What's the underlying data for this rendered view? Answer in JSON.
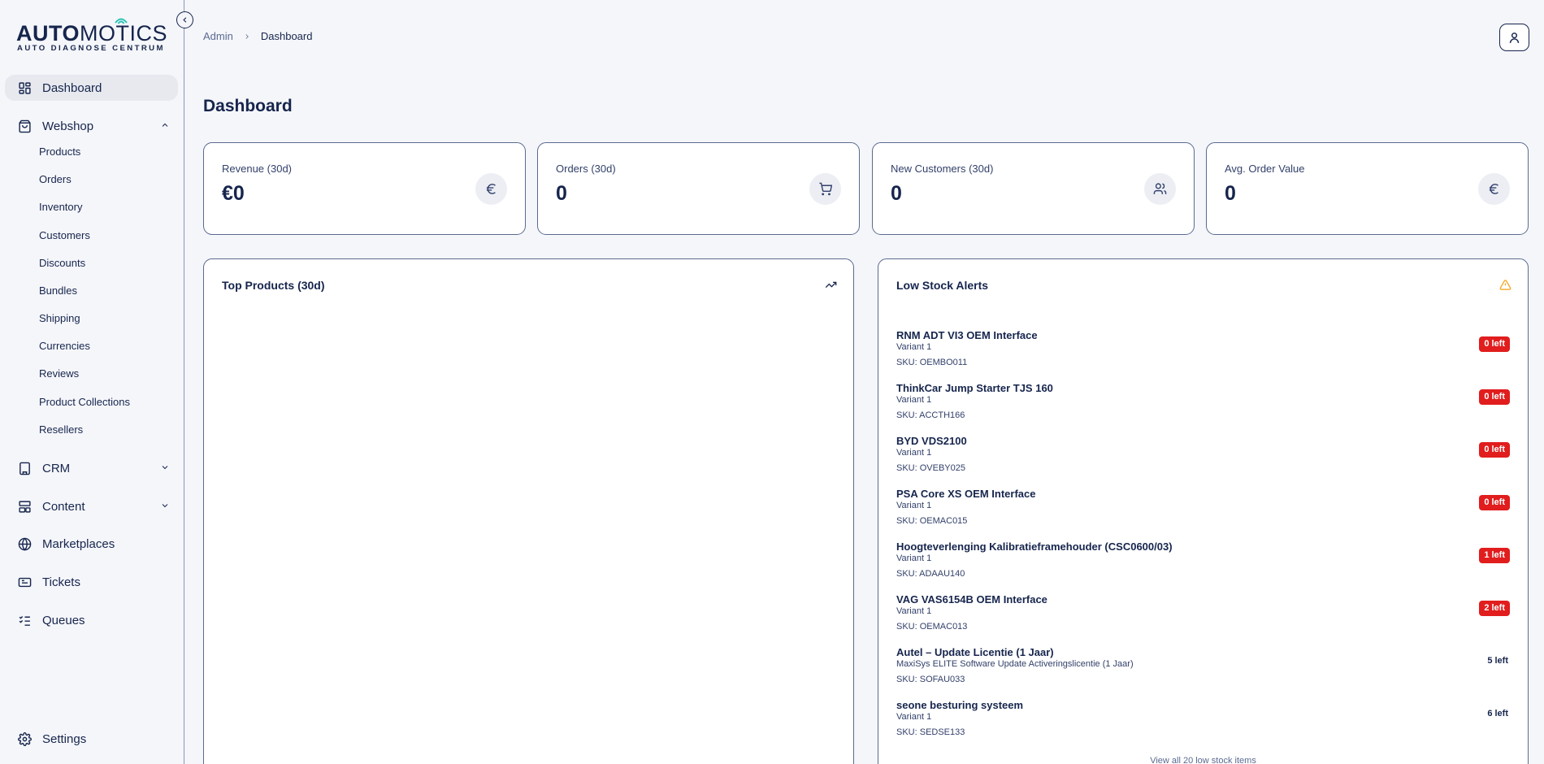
{
  "brand": {
    "name_bold": "AUTO",
    "name_light": "MOTICS",
    "tagline": "AUTO DIAGNOSE CENTRUM",
    "accent_color": "#2ec4b6"
  },
  "sidebar": {
    "items": [
      {
        "label": "Dashboard",
        "icon": "grid-icon",
        "active": true
      },
      {
        "label": "Webshop",
        "icon": "shopping-bag-icon",
        "expanded": true
      },
      {
        "label": "CRM",
        "icon": "building-icon",
        "expanded": false
      },
      {
        "label": "Content",
        "icon": "layout-icon",
        "expanded": false
      },
      {
        "label": "Marketplaces",
        "icon": "globe-icon"
      },
      {
        "label": "Tickets",
        "icon": "ticket-icon"
      },
      {
        "label": "Queues",
        "icon": "list-checks-icon"
      }
    ],
    "webshop_children": [
      "Products",
      "Orders",
      "Inventory",
      "Customers",
      "Discounts",
      "Bundles",
      "Shipping",
      "Currencies",
      "Reviews",
      "Product Collections",
      "Resellers"
    ],
    "settings_label": "Settings"
  },
  "breadcrumb": {
    "root": "Admin",
    "current": "Dashboard"
  },
  "page": {
    "title": "Dashboard"
  },
  "stats": [
    {
      "label": "Revenue (30d)",
      "value": "€0",
      "icon": "euro-icon"
    },
    {
      "label": "Orders (30d)",
      "value": "0",
      "icon": "cart-icon"
    },
    {
      "label": "New Customers (30d)",
      "value": "0",
      "icon": "users-icon"
    },
    {
      "label": "Avg. Order Value",
      "value": "0",
      "icon": "euro-icon"
    }
  ],
  "top_products": {
    "title": "Top Products (30d)",
    "icon": "trending-up-icon"
  },
  "low_stock": {
    "title": "Low Stock Alerts",
    "icon": "warning-icon",
    "warning_color": "#f59e0b",
    "alert_color": "#e11d1d",
    "items": [
      {
        "name": "RNM ADT VI3 OEM Interface",
        "variant": "Variant 1",
        "sku": "SKU: OEMBO011",
        "left": "0 left",
        "critical": true
      },
      {
        "name": "ThinkCar Jump Starter TJS 160",
        "variant": "Variant 1",
        "sku": "SKU: ACCTH166",
        "left": "0 left",
        "critical": true
      },
      {
        "name": "BYD VDS2100",
        "variant": "Variant 1",
        "sku": "SKU: OVEBY025",
        "left": "0 left",
        "critical": true
      },
      {
        "name": "PSA Core XS OEM Interface",
        "variant": "Variant 1",
        "sku": "SKU: OEMAC015",
        "left": "0 left",
        "critical": true
      },
      {
        "name": "Hoogteverlenging Kalibratieframehouder (CSC0600/03)",
        "variant": "Variant 1",
        "sku": "SKU: ADAAU140",
        "left": "1 left",
        "critical": true
      },
      {
        "name": "VAG VAS6154B OEM Interface",
        "variant": "Variant 1",
        "sku": "SKU: OEMAC013",
        "left": "2 left",
        "critical": true
      },
      {
        "name": "Autel – Update Licentie (1 Jaar)",
        "variant": "MaxiSys ELITE Software Update Activeringslicentie (1 Jaar)",
        "sku": "SKU: SOFAU033",
        "left": "5 left",
        "critical": false
      },
      {
        "name": "seone besturing systeem",
        "variant": "Variant 1",
        "sku": "SKU: SEDSE133",
        "left": "6 left",
        "critical": false
      }
    ],
    "view_all": "View all 20 low stock items"
  }
}
